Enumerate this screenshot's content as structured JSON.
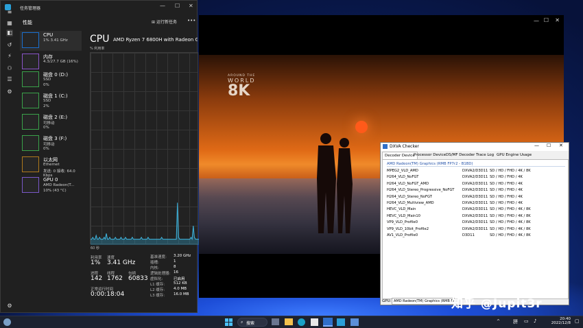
{
  "taskmgr": {
    "title": "任务管理器",
    "page_title": "性能",
    "run_task": "运行新任务",
    "more": "•••",
    "sidebar": [
      {
        "name": "CPU",
        "l2": "1% 3.41 GHz",
        "l3": ""
      },
      {
        "name": "内存",
        "l2": "4.3/27.7 GB (16%)",
        "l3": ""
      },
      {
        "name": "磁盘 0 (D:)",
        "l2": "SSD",
        "l3": "0%"
      },
      {
        "name": "磁盘 1 (C:)",
        "l2": "SSD",
        "l3": "2%"
      },
      {
        "name": "磁盘 2 (E:)",
        "l2": "可移动",
        "l3": "0%"
      },
      {
        "name": "磁盘 3 (F:)",
        "l2": "可移动",
        "l3": "0%"
      },
      {
        "name": "以太网",
        "l2": "Ethernet",
        "l3": "发送: 0 接收: 64.0 Kbps"
      },
      {
        "name": "GPU 0",
        "l2": "AMD Radeon(T...",
        "l3": "10% (43 °C)"
      }
    ],
    "cpu_title": "CPU",
    "cpu_model": "AMD Ryzen 7 6800H with Radeon Gr",
    "util_label": "% 利用率",
    "graph_time": "60 秒",
    "stats": {
      "util_l": "利用率",
      "util_v": "1%",
      "speed_l": "速度",
      "speed_v": "3.41 GHz",
      "proc_l": "进程",
      "proc_v": "142",
      "thr_l": "线程",
      "thr_v": "1762",
      "hnd_l": "句柄",
      "hnd_v": "60833",
      "up_l": "正常运行时间",
      "up_v": "0:00:18:04"
    },
    "specs": [
      {
        "l": "基准速度:",
        "v": "3.20 GHz"
      },
      {
        "l": "插槽:",
        "v": "1"
      },
      {
        "l": "内核:",
        "v": "8"
      },
      {
        "l": "逻辑处理器:",
        "v": "16"
      },
      {
        "l": "虚拟化:",
        "v": "已启用"
      },
      {
        "l": "L1 缓存:",
        "v": "512 KB"
      },
      {
        "l": "L2 缓存:",
        "v": "4.0 MB"
      },
      {
        "l": "L3 缓存:",
        "v": "16.0 MB"
      }
    ],
    "graph_values": [
      3,
      3,
      4,
      3,
      3,
      5,
      3,
      3,
      4,
      3,
      3,
      3,
      4,
      3,
      6,
      3,
      3,
      4,
      3,
      3,
      3,
      3,
      4,
      3,
      3,
      3,
      3,
      4,
      3,
      3,
      3,
      4,
      3,
      3,
      3,
      3,
      3,
      4,
      3,
      3,
      3,
      3,
      3,
      3,
      3,
      4,
      3,
      3,
      3,
      3,
      3,
      4,
      3,
      3,
      3,
      3,
      3,
      3,
      3,
      3,
      3,
      3,
      3,
      4,
      3,
      3,
      3,
      3,
      3,
      3,
      3,
      3,
      3,
      3,
      3,
      3,
      3,
      22,
      4,
      3,
      3,
      3,
      3,
      3,
      3,
      3,
      3,
      3,
      3,
      4,
      3,
      10,
      4,
      3,
      3,
      3,
      3
    ]
  },
  "video": {
    "logo_line1": "AROUND THE",
    "logo_line2": "WORLD",
    "logo_line3": "8K"
  },
  "dxva": {
    "title": "DXVA Checker",
    "tabs": [
      "Decoder Device",
      "Processor Device",
      "DS/MF Decoder",
      "Trace Log",
      "GPU Engine Usage"
    ],
    "device": "AMD Radeon(TM) Graphics (RMB FP7r2 - B1BD)",
    "rows": [
      [
        "MPEG2_VLD_AMD",
        "DXVA2/D3D11",
        "SD / HD / FHD / 4K / 8K"
      ],
      [
        "H264_VLD_NoFGT",
        "DXVA2/D3D11",
        "SD / HD / FHD / 4K"
      ],
      [
        "H264_VLD_NoFGT_AMD",
        "DXVA2/D3D11",
        "SD / HD / FHD / 4K"
      ],
      [
        "H264_VLD_Stereo_Progressive_NoFGT",
        "DXVA2/D3D11",
        "SD / HD / FHD / 4K"
      ],
      [
        "H264_VLD_Stereo_NoFGT",
        "DXVA2/D3D11",
        "SD / HD / FHD / 4K"
      ],
      [
        "H264_VLD_Multiview_AMD",
        "DXVA2/D3D11",
        "SD / HD / FHD / 4K"
      ],
      [
        "HEVC_VLD_Main",
        "DXVA2/D3D11",
        "SD / HD / FHD / 4K / 8K"
      ],
      [
        "HEVC_VLD_Main10",
        "DXVA2/D3D11",
        "SD / HD / FHD / 4K / 8K"
      ],
      [
        "VP9_VLD_Profile0",
        "DXVA2/D3D11",
        "SD / HD / FHD / 4K / 8K"
      ],
      [
        "VP9_VLD_10bit_Profile2",
        "DXVA2/D3D11",
        "SD / HD / FHD / 4K / 8K"
      ],
      [
        "AV1_VLD_Profile0",
        "D3D11",
        "SD / HD / FHD / 4K / 8K"
      ]
    ],
    "gpu_label": "GPU:",
    "gpu_value": "AMD Radeon(TM) Graphics (RMB FP7r2 - B1BD)"
  },
  "watermark": "知乎 @Jupit3r",
  "taskbar": {
    "search": "搜索",
    "ime": "拼",
    "time": "20:40",
    "date": "2022/12/8",
    "arrow": "^"
  }
}
